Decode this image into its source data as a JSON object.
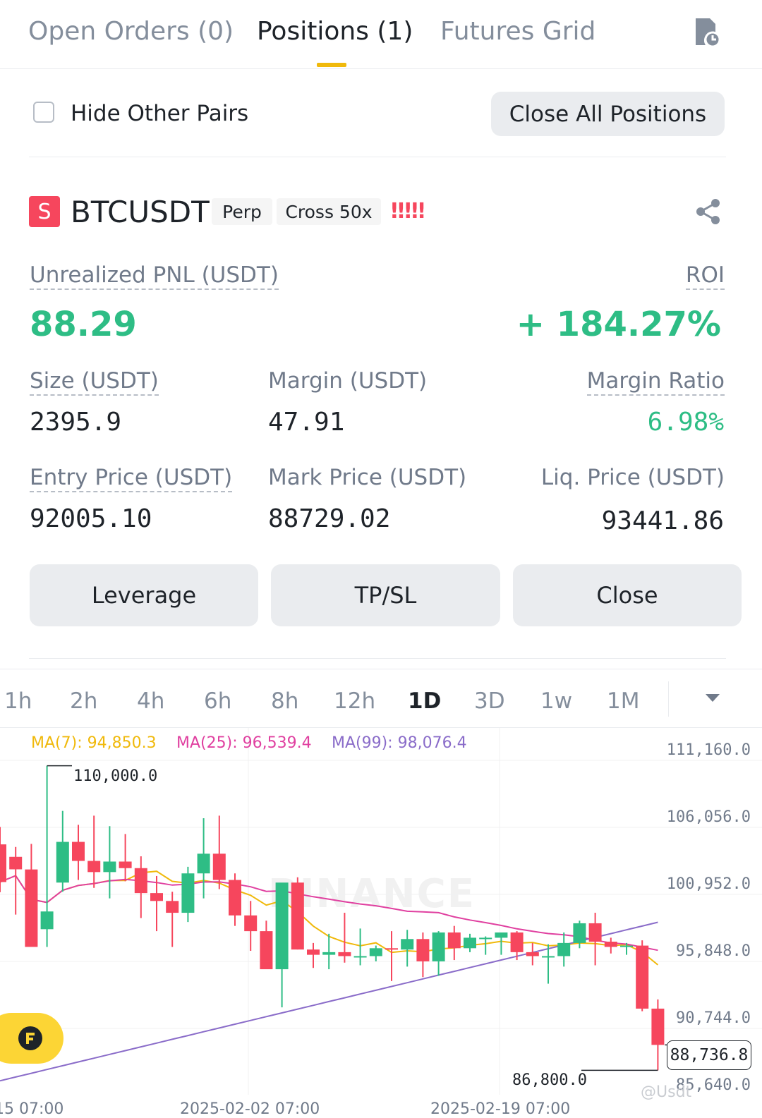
{
  "tabs": [
    {
      "label": "Open Orders (0)",
      "active": false
    },
    {
      "label": "Positions (1)",
      "active": true
    },
    {
      "label": "Futures Grid",
      "active": false
    }
  ],
  "filter": {
    "hide_other_pairs": "Hide Other Pairs",
    "close_all": "Close All Positions",
    "hide_checked": false
  },
  "position": {
    "side_badge": "S",
    "symbol": "BTCUSDT",
    "type_chip": "Perp",
    "margin_chip": "Cross 50x",
    "risk_marker": "!!!!!",
    "pnl_label": "Unrealized PNL (USDT)",
    "pnl_value": "88.29",
    "roi_label": "ROI",
    "roi_value": "+ 184.27%",
    "size_label": "Size (USDT)",
    "size_value": "2395.9",
    "margin_label": "Margin (USDT)",
    "margin_value": "47.91",
    "margin_ratio_label": "Margin Ratio",
    "margin_ratio_value": "6.98%",
    "entry_label": "Entry Price (USDT)",
    "entry_value": "92005.10",
    "mark_label": "Mark Price (USDT)",
    "mark_value": "88729.02",
    "liq_label": "Liq. Price (USDT)",
    "liq_value": "93441.86"
  },
  "actions": {
    "leverage": "Leverage",
    "tpsl": "TP/SL",
    "close": "Close"
  },
  "intervals": [
    "1h",
    "2h",
    "4h",
    "6h",
    "8h",
    "12h",
    "1D",
    "3D",
    "1w",
    "1M"
  ],
  "active_interval": "1D",
  "chart": {
    "ma7": "MA(7): 94,850.3",
    "ma25": "MA(25): 96,539.4",
    "ma99": "MA(99): 98,076.4",
    "price_labels": [
      "111,160.0",
      "106,056.0",
      "100,952.0",
      "95,848.0",
      "90,744.0",
      "85,640.0"
    ],
    "high_marker": "110,000.0",
    "low_marker": "86,800.0",
    "current_price": "88,736.8",
    "watermark": "BINANCE",
    "date_labels": [
      "15 07:00",
      "2025-02-02 07:00",
      "2025-02-19 07:00"
    ],
    "credit": "@Usdt"
  },
  "colors": {
    "up": "#2ebd85",
    "down": "#f6465d",
    "accent": "#f0b90b",
    "ma7": "#f0b90b",
    "ma25": "#e040a0",
    "ma99": "#8a6cc9"
  },
  "chart_data": {
    "type": "candlestick",
    "xlabel": "",
    "ylabel": "",
    "ylim": [
      85640,
      111160
    ],
    "series": [
      {
        "name": "MA(7)",
        "value": 94850.3
      },
      {
        "name": "MA(25)",
        "value": 96539.4
      },
      {
        "name": "MA(99)",
        "value": 98076.4
      }
    ],
    "candles": [
      [
        104010,
        105340,
        100370,
        101140
      ],
      [
        103060,
        103810,
        98660,
        102110
      ],
      [
        102100,
        104050,
        97550,
        96200
      ],
      [
        97550,
        110000,
        96200,
        98900
      ],
      [
        101100,
        106560,
        100400,
        104200
      ],
      [
        104200,
        105500,
        101300,
        102750
      ],
      [
        102750,
        106200,
        100700,
        101900
      ],
      [
        101900,
        105400,
        99900,
        102700
      ],
      [
        102700,
        104800,
        101200,
        102200
      ],
      [
        102200,
        103100,
        98400,
        100300
      ],
      [
        100300,
        101600,
        97400,
        99700
      ],
      [
        99700,
        100400,
        96200,
        98800
      ],
      [
        98800,
        102300,
        98100,
        101800
      ],
      [
        101800,
        106000,
        99900,
        103300
      ],
      [
        103300,
        106200,
        100600,
        101300
      ],
      [
        101300,
        101800,
        97800,
        98600
      ],
      [
        98600,
        99700,
        95900,
        97400
      ],
      [
        97400,
        98200,
        94600,
        94500
      ],
      [
        94500,
        100500,
        91600,
        101100
      ],
      [
        101100,
        101500,
        96000,
        96000
      ],
      [
        96000,
        96500,
        94600,
        95600
      ],
      [
        95600,
        97200,
        94500,
        95800
      ],
      [
        95800,
        98800,
        95000,
        95500
      ],
      [
        95500,
        97600,
        94800,
        95500
      ],
      [
        95500,
        96300,
        95100,
        96100
      ],
      [
        96100,
        97400,
        93600,
        96000
      ],
      [
        96000,
        97500,
        94700,
        96800
      ],
      [
        96800,
        97300,
        93900,
        95100
      ],
      [
        95100,
        97400,
        94000,
        97300
      ],
      [
        97300,
        97800,
        95200,
        96100
      ],
      [
        96100,
        97200,
        95800,
        96900
      ],
      [
        96900,
        97000,
        95600,
        96900
      ],
      [
        96900,
        97000,
        95600,
        97300
      ],
      [
        97300,
        97400,
        95200,
        95800
      ],
      [
        95800,
        96500,
        94800,
        95500
      ],
      [
        95500,
        96400,
        93400,
        95500
      ],
      [
        95500,
        97300,
        94700,
        96500
      ],
      [
        96500,
        98200,
        96100,
        98000
      ],
      [
        98000,
        98800,
        94800,
        96600
      ],
      [
        96600,
        96900,
        95700,
        96200
      ],
      [
        96200,
        96500,
        95600,
        96300
      ],
      [
        96300,
        96700,
        91300,
        91500
      ],
      [
        91500,
        92200,
        86800,
        88737
      ]
    ]
  }
}
